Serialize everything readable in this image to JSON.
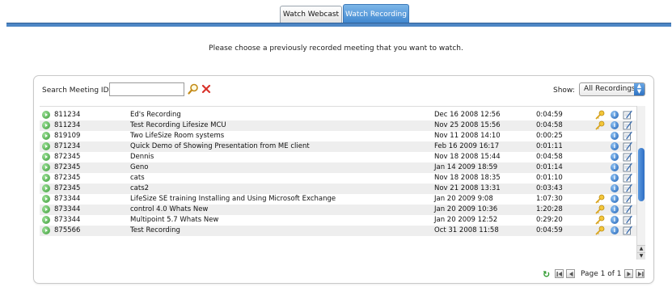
{
  "tabs": {
    "webcast": "Watch Webcast",
    "recording": "Watch Recording"
  },
  "intro": "Please choose a previously recorded meeting that you want to watch.",
  "search": {
    "label": "Search Meeting ID:",
    "value": "",
    "placeholder": ""
  },
  "show": {
    "label": "Show:",
    "selected": "All Recordings"
  },
  "recordings": [
    {
      "id": "811234",
      "name": "Ed's Recording",
      "date": "Dec 16 2008 12:56",
      "duration": "0:04:59",
      "key": true
    },
    {
      "id": "811234",
      "name": "Test Recording Lifesize MCU",
      "date": "Nov 25 2008 15:56",
      "duration": "0:04:58",
      "key": true
    },
    {
      "id": "819109",
      "name": "Two LifeSize Room systems",
      "date": "Nov 11 2008 14:10",
      "duration": "0:00:25",
      "key": false
    },
    {
      "id": "871234",
      "name": "Quick Demo of Showing Presentation from ME client",
      "date": "Feb 16 2009 16:17",
      "duration": "0:01:11",
      "key": false
    },
    {
      "id": "872345",
      "name": "Dennis",
      "date": "Nov 18 2008 15:44",
      "duration": "0:04:58",
      "key": false
    },
    {
      "id": "872345",
      "name": "Geno",
      "date": "Jan 14 2009 18:59",
      "duration": "0:01:14",
      "key": false
    },
    {
      "id": "872345",
      "name": "cats",
      "date": "Nov 18 2008 18:35",
      "duration": "0:01:10",
      "key": false
    },
    {
      "id": "872345",
      "name": "cats2",
      "date": "Nov 21 2008 13:31",
      "duration": "0:03:43",
      "key": false
    },
    {
      "id": "873344",
      "name": "LifeSize SE training Installing and Using Microsoft Exchange",
      "date": "Jan 20 2009 9:08",
      "duration": "1:07:30",
      "key": true
    },
    {
      "id": "873344",
      "name": "control 4.0 Whats New",
      "date": "Jan 20 2009 10:36",
      "duration": "1:20:28",
      "key": true
    },
    {
      "id": "873344",
      "name": "Multipoint 5.7 Whats New",
      "date": "Jan 20 2009 12:52",
      "duration": "0:29:20",
      "key": true
    },
    {
      "id": "875566",
      "name": "Test Recording",
      "date": "Oct 31 2008 11:58",
      "duration": "0:04:59",
      "key": true
    }
  ],
  "pager": {
    "text": "Page 1 of 1"
  },
  "colors": {
    "accent": "#4d86c4",
    "row_alt": "#eeeeee",
    "clear": "#d9332b",
    "refresh": "#2e9a2e"
  }
}
